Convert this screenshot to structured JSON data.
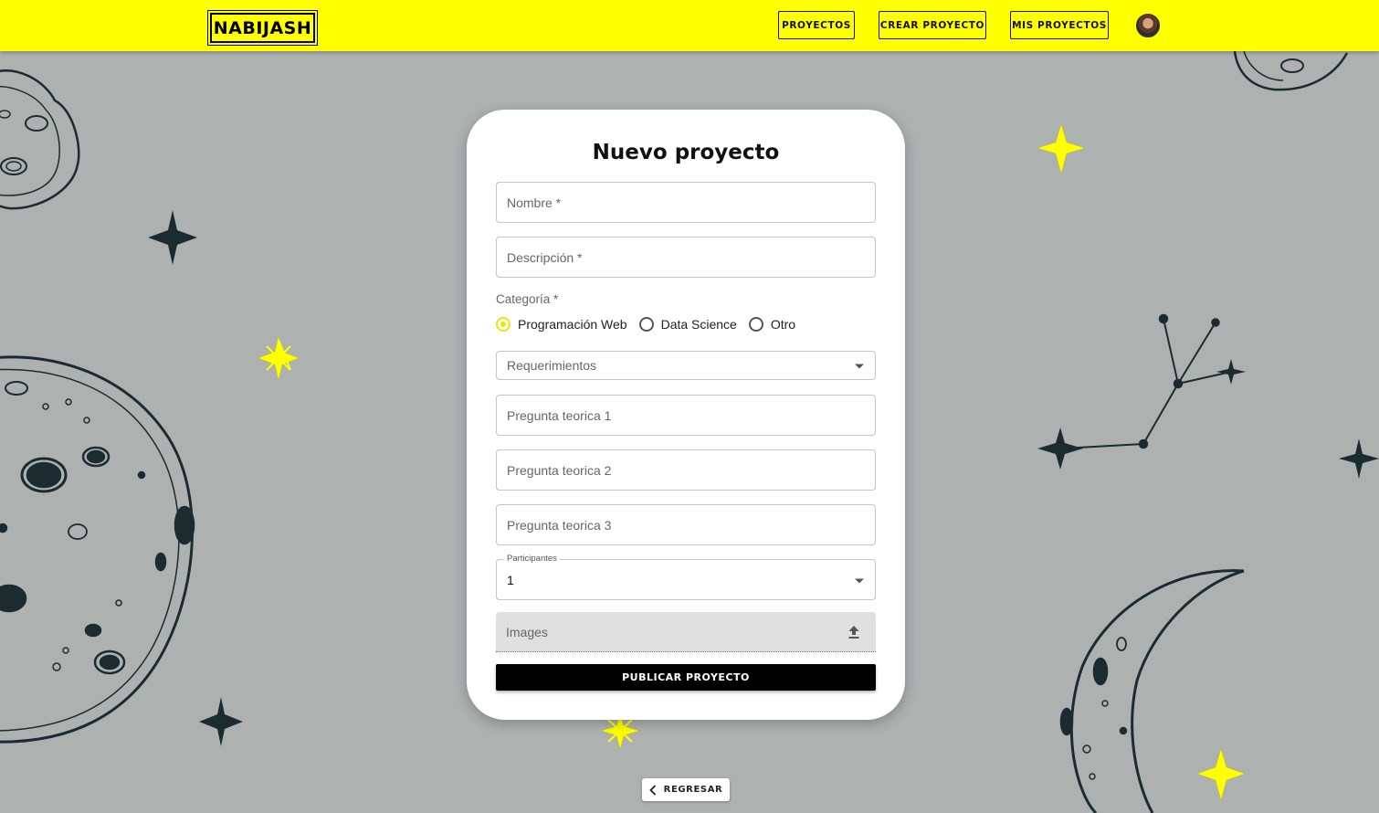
{
  "navbar": {
    "logo": "NABIJASH",
    "links": [
      "PROYECTOS",
      "CREAR PROYECTO",
      "MIS PROYECTOS"
    ]
  },
  "form": {
    "title": "Nuevo proyecto",
    "nombre_placeholder": "Nombre *",
    "descripcion_placeholder": "Descripción *",
    "categoria_label": "Categoría *",
    "categorias": [
      {
        "label": "Programación Web",
        "selected": true
      },
      {
        "label": "Data Science",
        "selected": false
      },
      {
        "label": "Otro",
        "selected": false
      }
    ],
    "requerimientos_placeholder": "Requerimientos",
    "preguntas": [
      "Pregunta teorica 1",
      "Pregunta teorica 2",
      "Pregunta teorica 3"
    ],
    "participantes_label": "Participantes",
    "participantes_value": "1",
    "images_label": "Images",
    "submit_label": "PUBLICAR PROYECTO"
  },
  "back_label": "REGRESAR",
  "colors": {
    "navbar": "#ffff00",
    "background": "#adb2b1",
    "accent": "#e8e800",
    "button": "#000000"
  }
}
